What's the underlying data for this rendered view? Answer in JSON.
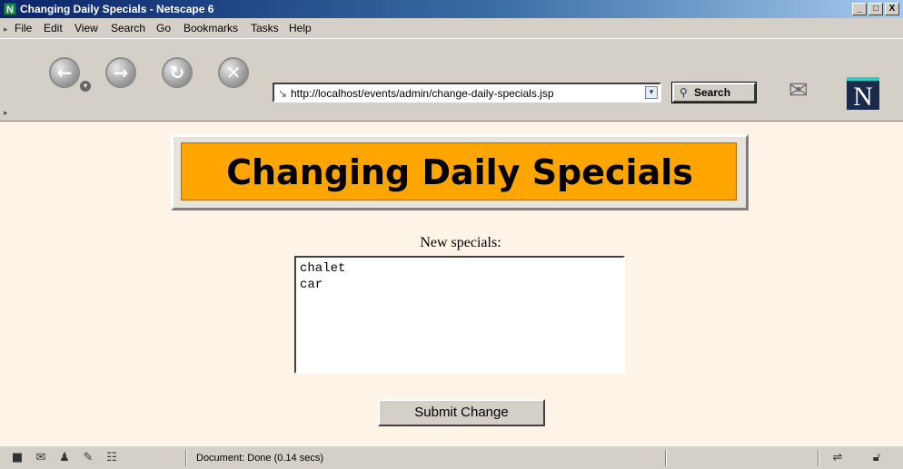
{
  "window": {
    "title": "Changing Daily Specials - Netscape 6",
    "app_icon": "N",
    "controls": [
      "_",
      "□",
      "X"
    ]
  },
  "menu": {
    "items": [
      "File",
      "Edit",
      "View",
      "Search",
      "Go",
      "Bookmarks",
      "Tasks",
      "Help"
    ]
  },
  "toolbar": {
    "nav_icons": [
      "back-icon",
      "forward-icon",
      "reload-icon",
      "stop-icon"
    ],
    "url": "http://localhost/events/admin/change-daily-specials.jsp",
    "search_label": "Search",
    "logo": "N"
  },
  "page": {
    "banner_title": "Changing Daily Specials",
    "field_label": "New specials:",
    "specials_value": "chalet\ncar",
    "submit_label": "Submit Change"
  },
  "status": {
    "text": "Document: Done (0.14 secs)"
  },
  "colors": {
    "page_bg": "#fdf3e6",
    "banner_bg": "#ffa500",
    "chrome": "#d4d0c8"
  }
}
